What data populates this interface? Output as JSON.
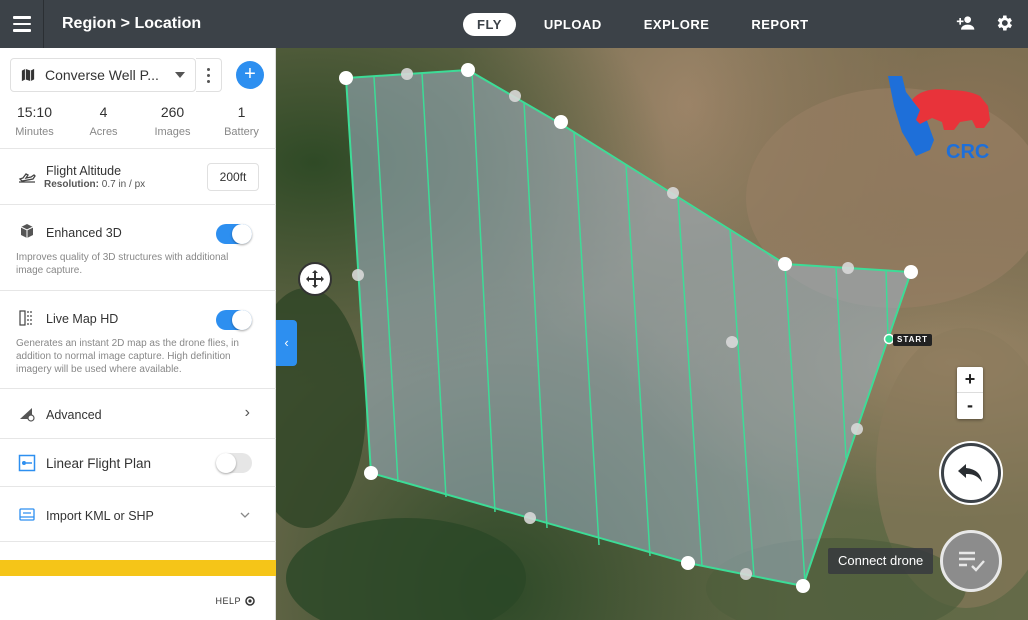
{
  "topbar": {
    "breadcrumb": "Region > Location",
    "tabs": [
      {
        "label": "FLY",
        "active": true
      },
      {
        "label": "UPLOAD",
        "active": false
      },
      {
        "label": "EXPLORE",
        "active": false
      },
      {
        "label": "REPORT",
        "active": false
      }
    ],
    "icons": [
      "add-user-icon",
      "gear-icon"
    ]
  },
  "sidebar": {
    "plan_name": "Converse Well P...",
    "add_label": "+",
    "stats": [
      {
        "value": "15:10",
        "label": "Minutes"
      },
      {
        "value": "4",
        "label": "Acres"
      },
      {
        "value": "260",
        "label": "Images"
      },
      {
        "value": "1",
        "label": "Battery"
      }
    ],
    "altitude": {
      "title": "Flight Altitude",
      "resolution_label": "Resolution:",
      "resolution_value": "0.7 in / px",
      "value": "200ft"
    },
    "enhanced3d": {
      "title": "Enhanced 3D",
      "desc": "Improves quality of 3D structures with additional image capture.",
      "enabled": true
    },
    "livemap": {
      "title": "Live Map HD",
      "desc": "Generates an instant 2D map as the drone flies, in addition to normal image capture. High definition imagery will be used where available.",
      "enabled": true
    },
    "advanced": {
      "title": "Advanced"
    },
    "linear": {
      "title": "Linear Flight Plan",
      "enabled": false
    },
    "import": {
      "title": "Import KML or SHP"
    },
    "help": "HELP"
  },
  "map": {
    "start_label": "START",
    "zoom_in": "+",
    "zoom_out": "-",
    "connect_label": "Connect drone",
    "logo_text": "CRC",
    "colors": {
      "path": "#3ddc97",
      "accent": "#2d8ff0",
      "logo_blue": "#1e6fd9",
      "logo_red": "#e8333a"
    }
  }
}
